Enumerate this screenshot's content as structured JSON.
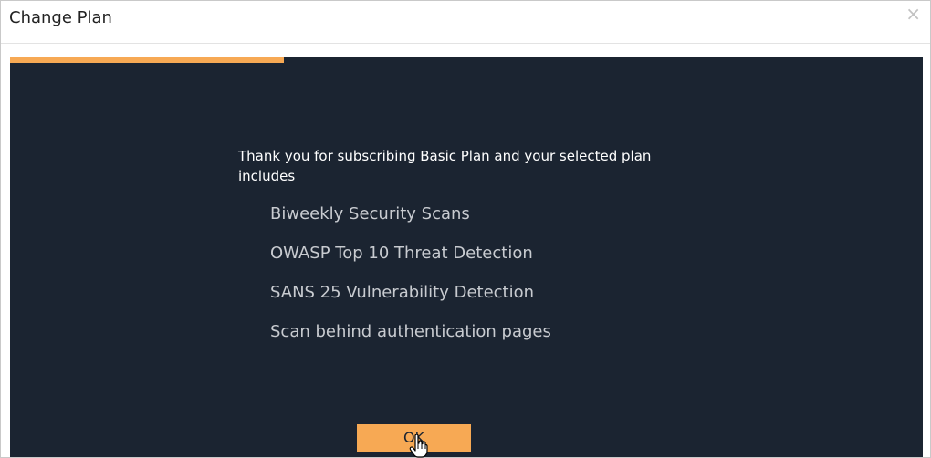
{
  "dialog": {
    "title": "Change Plan",
    "close_icon": "close-icon",
    "close_glyph": "×"
  },
  "progress": {
    "fraction": 0.3,
    "color": "#f7a954"
  },
  "body": {
    "background": "#1b2431",
    "intro": "Thank you for subscribing Basic Plan and your selected plan includes",
    "features": [
      "Biweekly Security Scans",
      "OWASP Top 10 Threat Detection",
      "SANS 25 Vulnerability Detection",
      "Scan behind authentication pages"
    ],
    "ok_label": "OK"
  },
  "cursor": {
    "icon": "hand-pointer-icon"
  }
}
